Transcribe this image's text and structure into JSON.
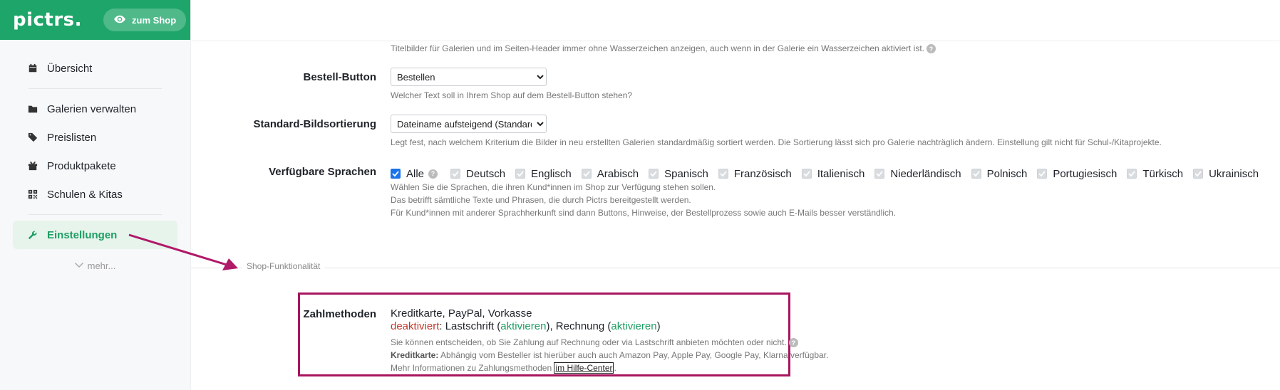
{
  "brand": {
    "logo": "pictrs.",
    "shop_button": "zum Shop"
  },
  "nav": {
    "items": [
      {
        "label": "Übersicht"
      },
      {
        "label": "Galerien verwalten"
      },
      {
        "label": "Preislisten"
      },
      {
        "label": "Produktpakete"
      },
      {
        "label": "Schulen & Kitas"
      },
      {
        "label": "Einstellungen"
      }
    ],
    "more": "mehr..."
  },
  "settings": {
    "top_help": "Titelbilder für Galerien und im Seiten-Header immer ohne Wasserzeichen anzeigen, auch wenn in der Galerie ein Wasserzeichen aktiviert ist.",
    "order_button": {
      "label": "Bestell-Button",
      "value": "Bestellen",
      "help": "Welcher Text soll in Ihrem Shop auf dem Bestell-Button stehen?"
    },
    "sorting": {
      "label": "Standard-Bildsortierung",
      "value": "Dateiname aufsteigend (Standard)",
      "help": "Legt fest, nach welchem Kriterium die Bilder in neu erstellten Galerien standardmäßig sortiert werden. Die Sortierung lässt sich pro Galerie nachträglich ändern. Einstellung gilt nicht für Schul-/Kitaprojekte."
    },
    "languages": {
      "label": "Verfügbare Sprachen",
      "all": "Alle",
      "list": [
        "Deutsch",
        "Englisch",
        "Arabisch",
        "Spanisch",
        "Französisch",
        "Italienisch",
        "Niederländisch",
        "Polnisch",
        "Portugiesisch",
        "Türkisch",
        "Ukrainisch"
      ],
      "help1": "Wählen Sie die Sprachen, die ihren Kund*innen im Shop zur Verfügung stehen sollen.",
      "help2": "Das betrifft sämtliche Texte und Phrasen, die durch Pictrs bereitgestellt werden.",
      "help3": "Für Kund*innen mit anderer Sprachherkunft sind dann Buttons, Hinweise, der Bestellprozess sowie auch E-Mails besser verständlich."
    }
  },
  "section": {
    "title": "Shop-Funktionalität"
  },
  "payment": {
    "label": "Zahlmethoden",
    "methods": "Kreditkarte, PayPal, Vorkasse",
    "deactivated": "deaktiviert",
    "sep": ": ",
    "lastschrift": "Lastschrift (",
    "activate": "aktivieren",
    "close_comma": "), ",
    "rechnung": "Rechnung (",
    "close": ")",
    "help1": "Sie können entscheiden, ob Sie Zahlung auf Rechnung oder via Lastschrift anbieten möchten oder nicht.",
    "help2_bold": "Kreditkarte:",
    "help2": " Abhängig vom Besteller ist hierüber auch auch Amazon Pay, Apple Pay, Google Pay, Klarna verfügbar.",
    "help3": "Mehr Informationen zu Zahlungsmethoden ",
    "help3_link": "im Hilfe-Center",
    "help3_end": "."
  },
  "colors": {
    "brand": "#1ea66a",
    "active_bg": "#e6f4ec",
    "highlight": "#a8155e",
    "deactivated": "#c0392b",
    "activate": "#1e9e63"
  }
}
